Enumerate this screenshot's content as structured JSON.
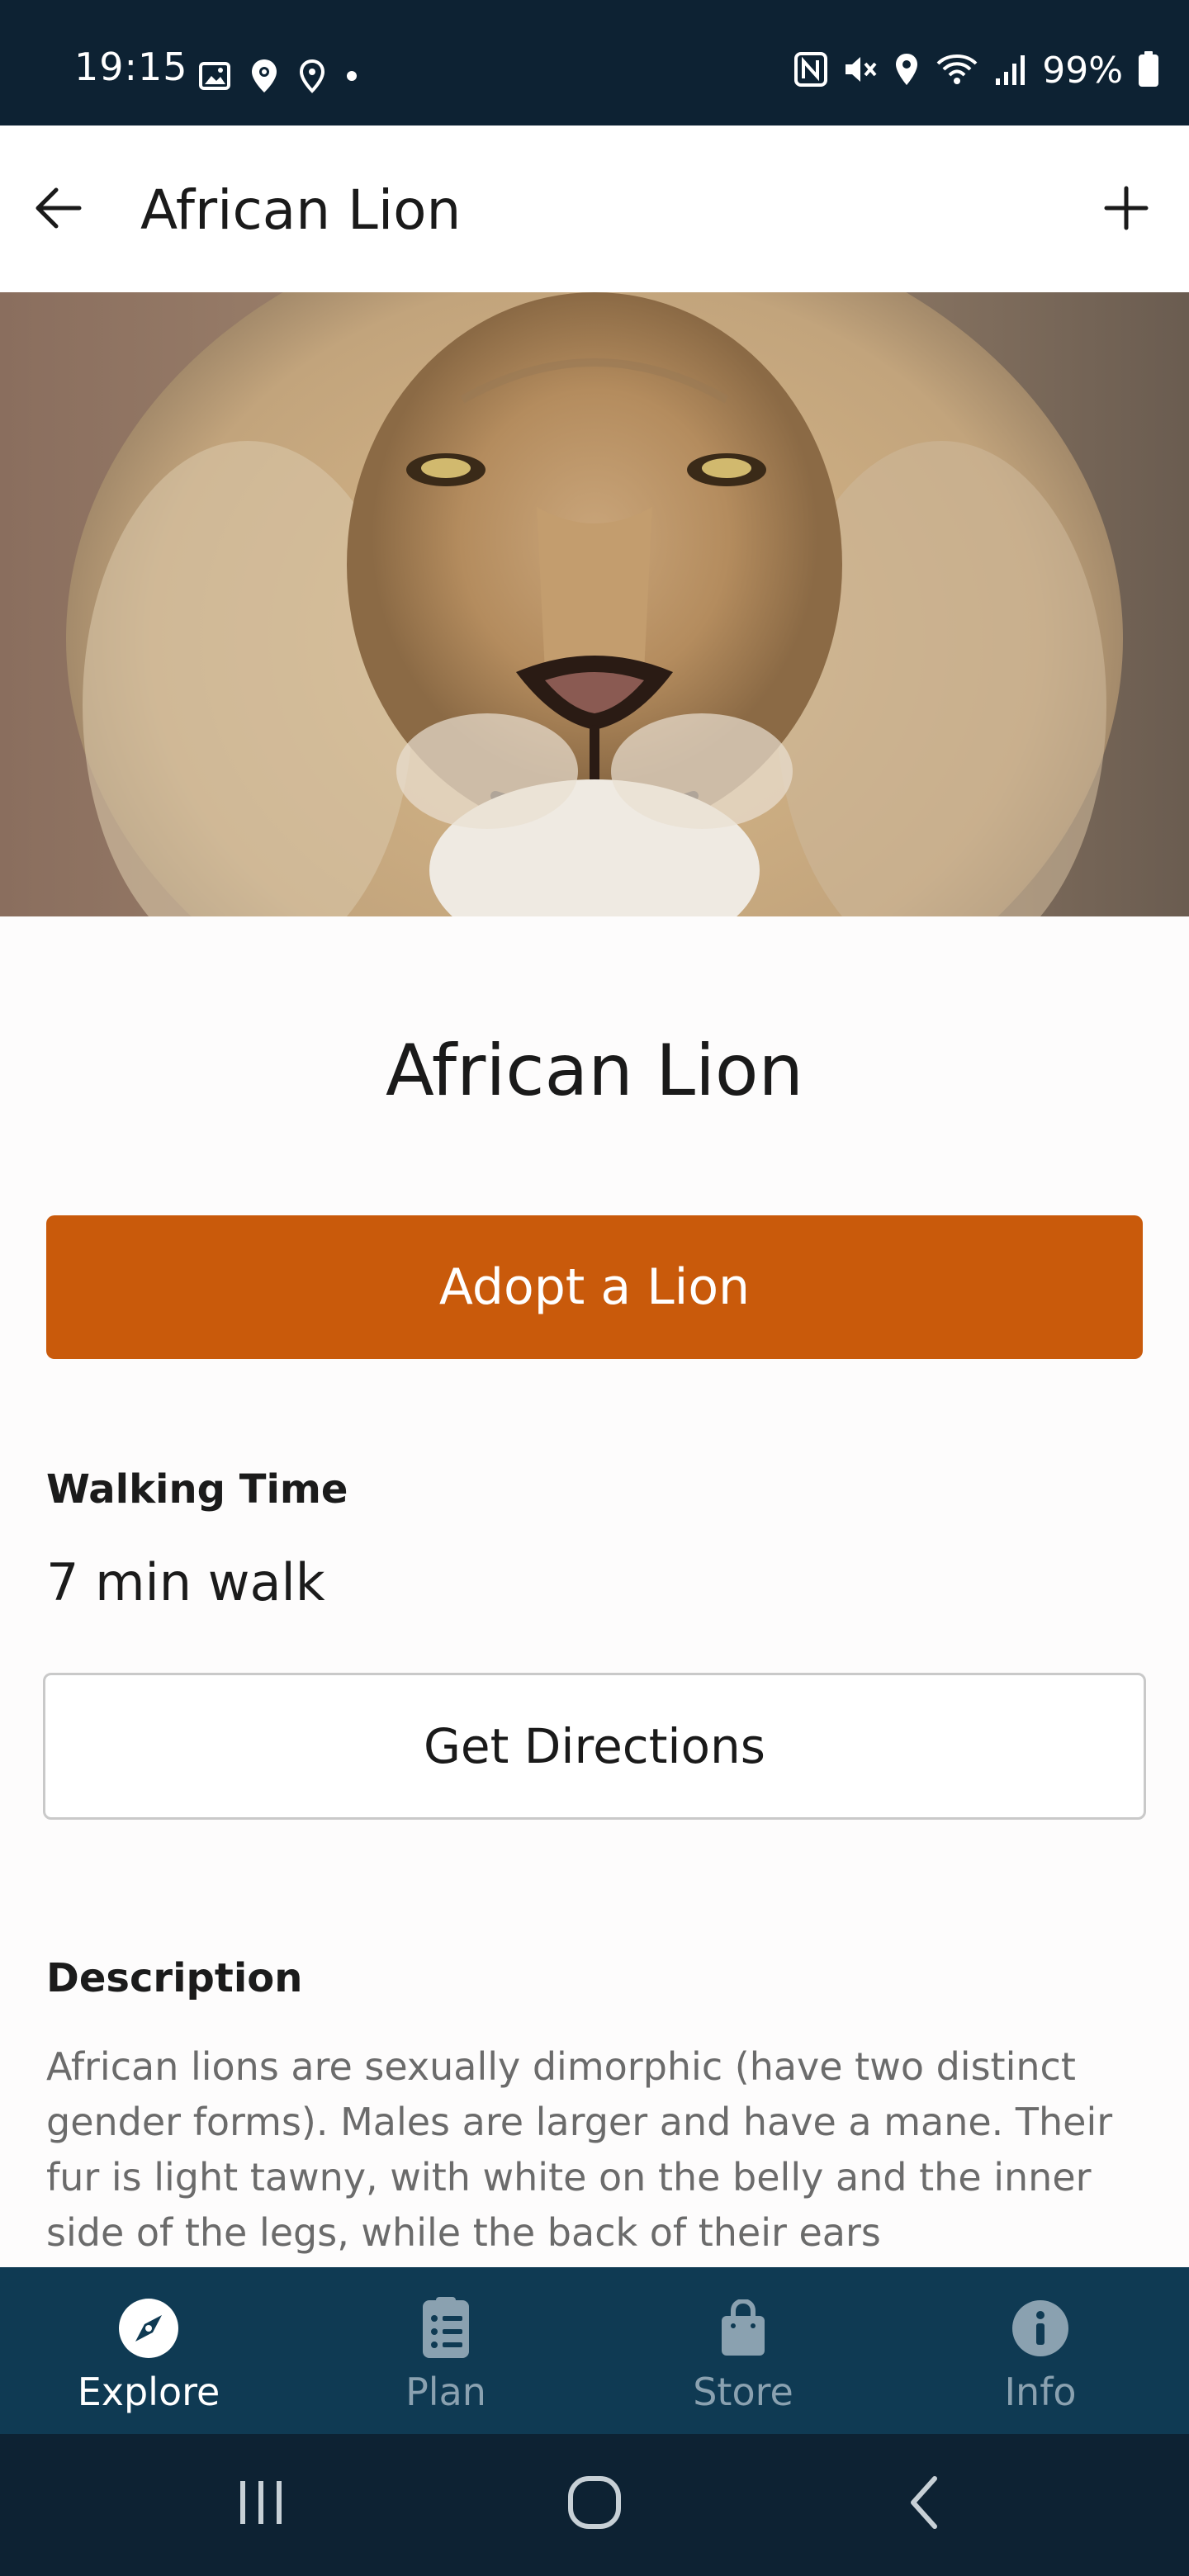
{
  "status_bar": {
    "time": "19:15",
    "battery_percent": "99%",
    "left_icons": [
      "image-icon",
      "location-pin-icon",
      "location-outline-icon",
      "dot-icon"
    ],
    "right_icons": [
      "nfc-icon",
      "mute-icon",
      "location-icon",
      "wifi-icon",
      "signal-icon",
      "battery-icon"
    ]
  },
  "app_bar": {
    "title": "African Lion",
    "back_icon": "back-arrow-icon",
    "action_icon": "plus-icon"
  },
  "hero": {
    "image": "lion-face-photo"
  },
  "animal": {
    "name": "African Lion",
    "adopt_label": "Adopt a Lion",
    "walking_time_heading": "Walking Time",
    "walking_time_value": "7 min walk",
    "directions_label": "Get Directions",
    "description_heading": "Description",
    "description_text": "African lions are sexually dimorphic (have two distinct gender forms). Males are larger and have a mane. Their fur is light tawny, with white on the belly and the inner side of the legs, while the back of their ears"
  },
  "bottom_nav": {
    "items": [
      {
        "label": "Explore",
        "icon": "compass-icon",
        "active": true
      },
      {
        "label": "Plan",
        "icon": "checklist-icon",
        "active": false
      },
      {
        "label": "Store",
        "icon": "shopping-bag-icon",
        "active": false
      },
      {
        "label": "Info",
        "icon": "info-icon",
        "active": false
      }
    ]
  },
  "colors": {
    "status_bar_bg": "#0d2233",
    "accent_orange": "#c95a0b",
    "nav_bg": "#0f3a53",
    "nav_inactive": "#8aa1b0"
  }
}
